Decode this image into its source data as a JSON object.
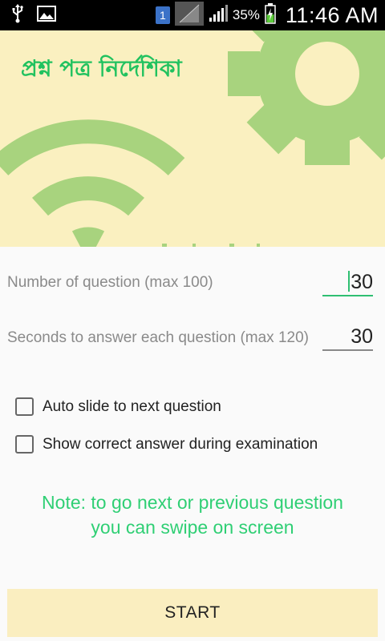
{
  "status_bar": {
    "sim_number": "1",
    "battery_percent": "35%",
    "time": "11:46 AM",
    "icons": [
      "usb-icon",
      "image-icon",
      "sim-icon",
      "no-signal-icon",
      "signal-icon",
      "battery-charging-icon"
    ]
  },
  "banner": {
    "title": "প্রশ্ন পত্র নির্দেশিকা",
    "background_color": "#faf0c0",
    "graphic_color": "#a8d37e",
    "icons": [
      "gear-icon",
      "wifi-icon"
    ]
  },
  "form": {
    "question_count": {
      "label": "Number of question (max 100)",
      "value": "30"
    },
    "seconds_per_question": {
      "label": "Seconds to answer each question (max 120)",
      "value": "30"
    },
    "options": [
      {
        "label": "Auto slide to next question",
        "checked": false
      },
      {
        "label": "Show correct answer during examination",
        "checked": false
      }
    ]
  },
  "note": {
    "line1": "Note: to go next or previous question",
    "line2": "you can swipe on screen"
  },
  "start_button": {
    "label": "START"
  },
  "colors": {
    "accent": "#2fbf72",
    "button_bg": "#faeec0"
  }
}
